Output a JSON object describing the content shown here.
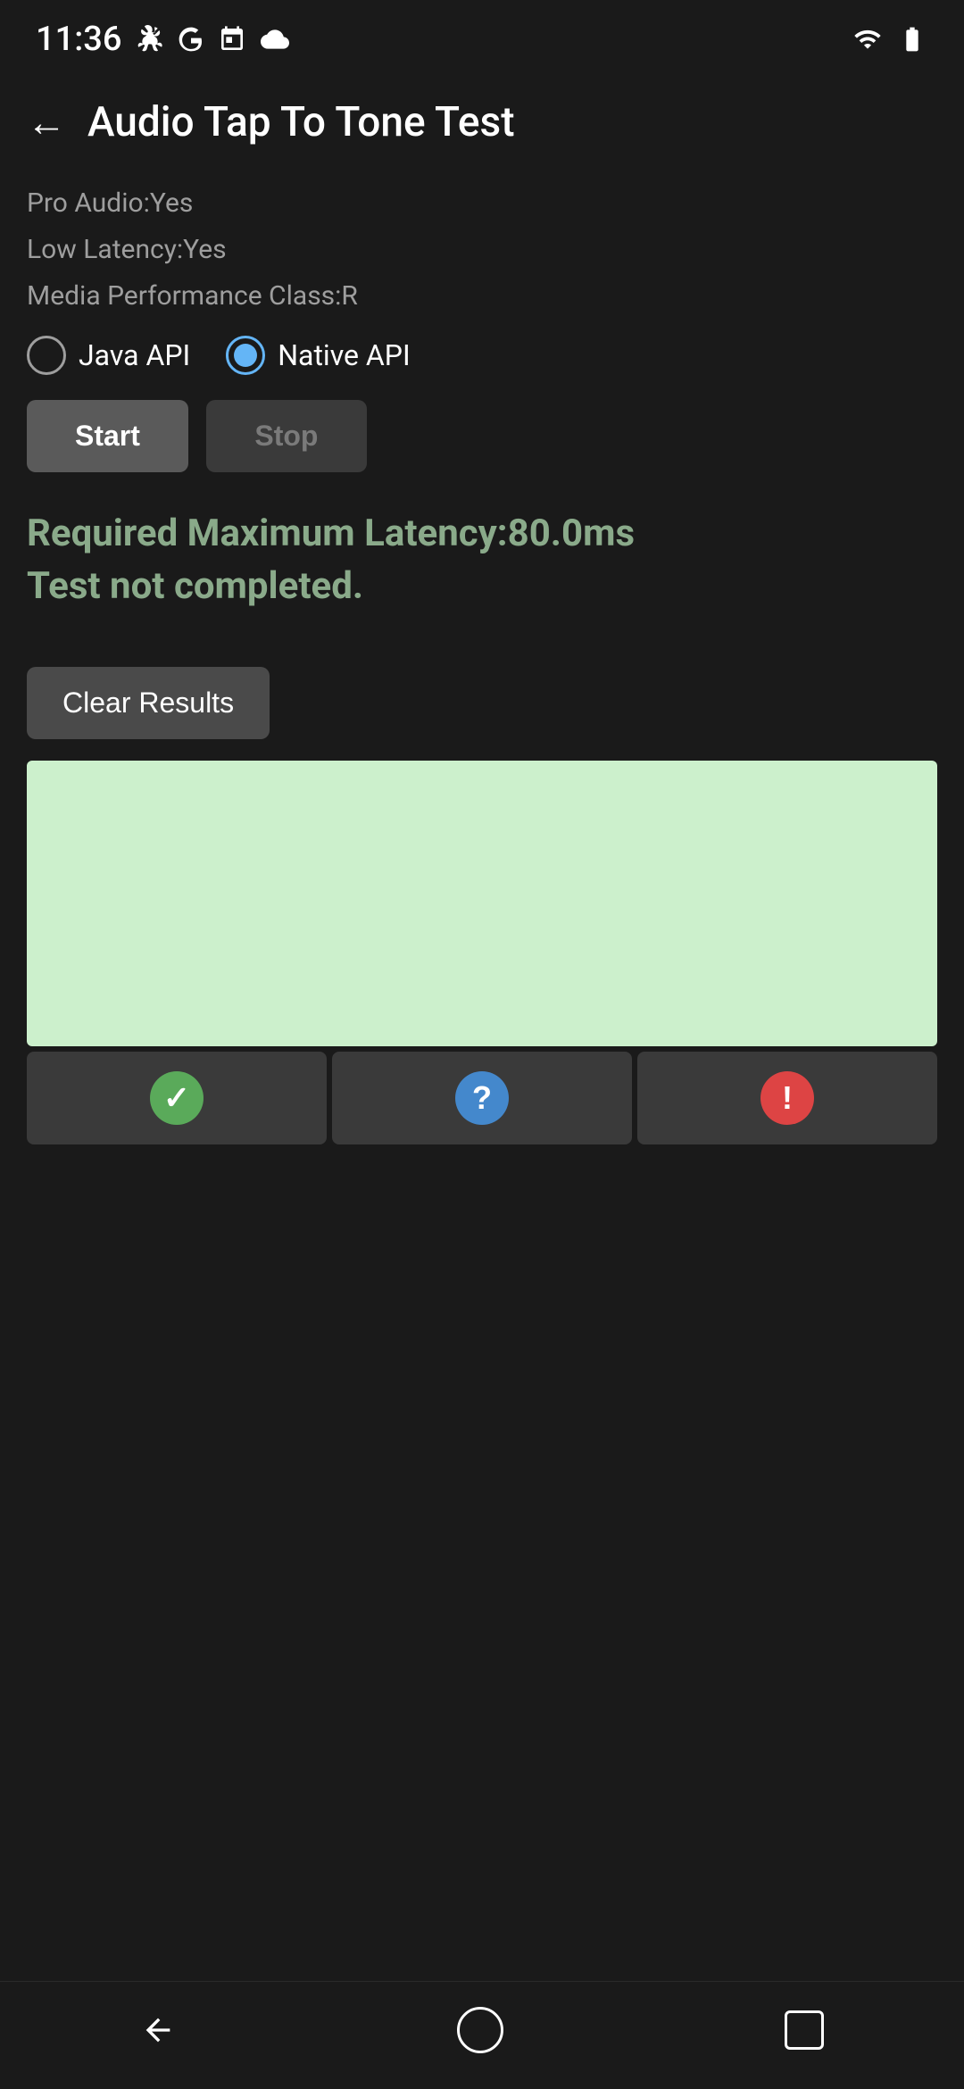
{
  "statusBar": {
    "time": "11:36",
    "iconsLeft": [
      "fan-icon",
      "google-icon",
      "calendar-icon",
      "cloud-icon"
    ],
    "iconsRight": [
      "wifi-icon",
      "battery-icon"
    ]
  },
  "header": {
    "backLabel": "←",
    "title": "Audio Tap To Tone Test"
  },
  "deviceInfo": {
    "proAudio": "Pro Audio:Yes",
    "lowLatency": "Low Latency:Yes",
    "mediaPerformance": "Media Performance Class:R"
  },
  "radioGroup": {
    "options": [
      {
        "label": "Java API",
        "selected": false
      },
      {
        "label": "Native API",
        "selected": true
      }
    ]
  },
  "buttons": {
    "start": "Start",
    "stop": "Stop"
  },
  "results": {
    "line1": "Required Maximum Latency:80.0ms",
    "line2": "Test not completed."
  },
  "clearButton": "Clear Results",
  "statusIcons": {
    "checkLabel": "✓",
    "questionLabel": "?",
    "warningLabel": "!"
  },
  "navbar": {
    "back": "◀",
    "home": "",
    "recent": ""
  }
}
